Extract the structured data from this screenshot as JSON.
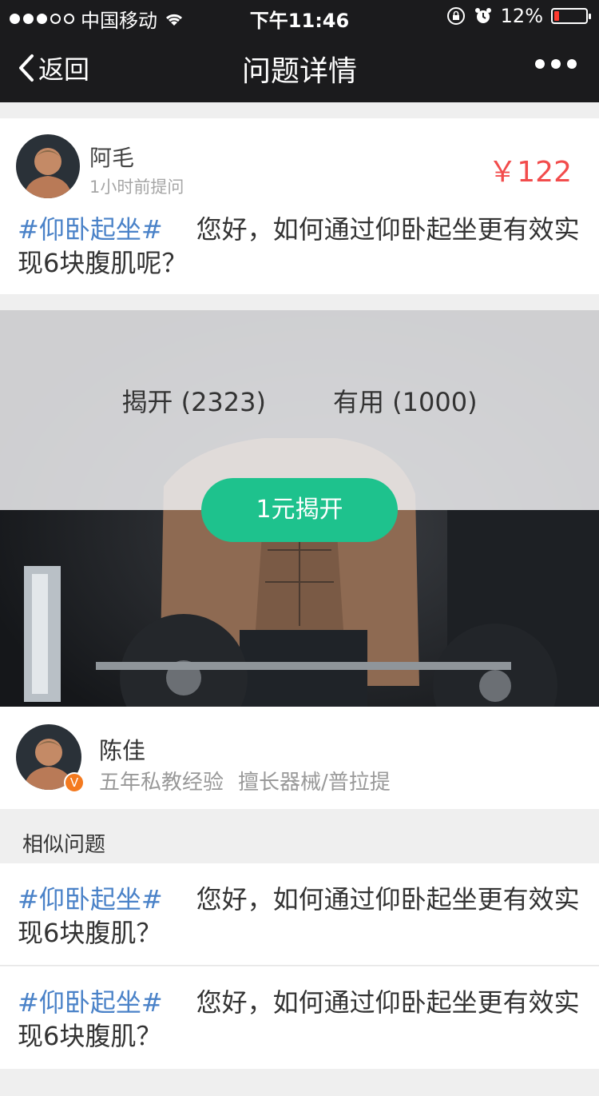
{
  "status_bar": {
    "carrier": "中国移动",
    "time": "下午11:46",
    "battery": "12%",
    "battery_level": 0.12
  },
  "nav": {
    "back_label": "返回",
    "title": "问题详情"
  },
  "question": {
    "asker_name": "阿毛",
    "asked_time": "1小时前提问",
    "price": "￥122",
    "tag": "#仰卧起坐#",
    "text": "您好，如何通过仰卧起坐更有效实现6块腹肌呢？"
  },
  "reveal": {
    "reveal_count_label": "揭开 (2323)",
    "useful_count_label": "有用 (1000)",
    "unlock_button": "1元揭开"
  },
  "coach": {
    "name": "陈佳",
    "badge": "V",
    "experience": "五年私教经验",
    "specialty": "擅长器械/普拉提"
  },
  "similar": {
    "heading": "相似问题",
    "items": [
      {
        "tag": "#仰卧起坐#",
        "text": "您好，如何通过仰卧起坐更有效实现6块腹肌？"
      },
      {
        "tag": "#仰卧起坐#",
        "text": "您好，如何通过仰卧起坐更有效实现6块腹肌？"
      }
    ]
  },
  "colors": {
    "nav_bg": "#1b1b1d",
    "tag_blue": "#4a82c8",
    "price_red": "#f24c4c",
    "button_green": "#1ec28d",
    "badge_orange": "#f47a1f"
  }
}
